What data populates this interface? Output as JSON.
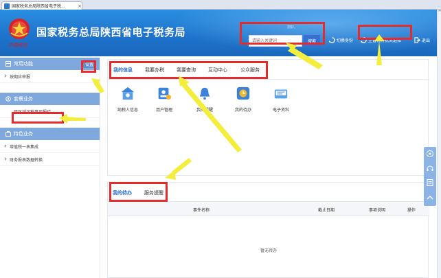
{
  "browser": {
    "tab_title": "国家税务总局陕西省电子税...",
    "tab_close": "×",
    "scroll_up": "^"
  },
  "header": {
    "emblem_script": "中国税务",
    "site_title": "国家税务总局陕西省电子税务局",
    "tiny_notice": "您好,",
    "search_placeholder": "请输入关键词",
    "search_button": "搜索",
    "switch_identity": "切换身份",
    "tax_authority": "主管税务机关选择",
    "logout": "退出"
  },
  "sidebar": {
    "common_title": "常用功能",
    "settings_label": "设置",
    "common_items": [
      "按期应申报"
    ],
    "tax_service_title": "套餐业务",
    "tax_service_items": [
      "跨区域涉税事项报验"
    ],
    "special_title": "特色业务",
    "special_items": [
      "增值税一表集成",
      "财务报表数据转换"
    ]
  },
  "info_tabs": [
    "我的信息",
    "我要办税",
    "我要查询",
    "互动中心",
    "公众服务"
  ],
  "functions": [
    {
      "label": "纳税人信息",
      "icon": "taxpayer-info-icon"
    },
    {
      "label": "用户管理",
      "icon": "user-management-icon"
    },
    {
      "label": "我的提醒",
      "icon": "bell-icon"
    },
    {
      "label": "我的待办",
      "icon": "clock-icon"
    },
    {
      "label": "电子资料",
      "icon": "electronic-data-icon"
    }
  ],
  "todo_tabs": [
    "我的待办",
    "服务提醒"
  ],
  "todo_table": {
    "columns": [
      "事件名称",
      "截止日期",
      "事项说明",
      "操作"
    ],
    "empty_text": "暂无待办"
  },
  "colors": {
    "header_blue": "#1e74cc",
    "accent_blue": "#2c6fd1",
    "annotation_red": "#e52b2b",
    "arrow_yellow": "#f3ee3c"
  }
}
